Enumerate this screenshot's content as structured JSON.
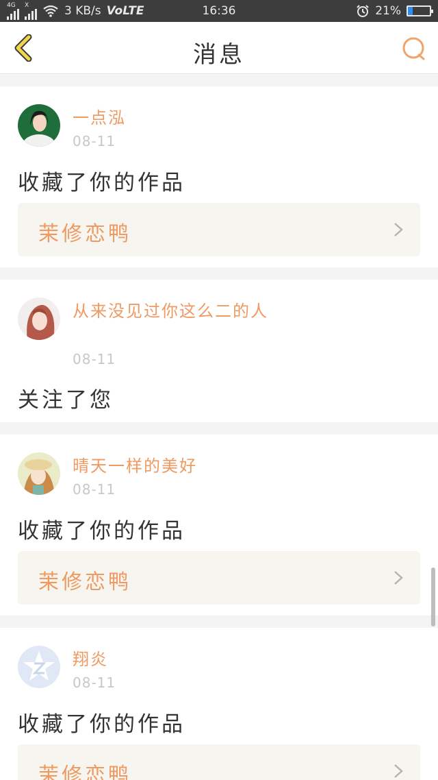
{
  "status_bar": {
    "network_top": "4G",
    "network_mark": "X",
    "speed": "3 KB/s",
    "volte": "VoLTE",
    "time": "16:36",
    "battery_text": "21%",
    "battery_level": 0.21,
    "battery_color": "#2e8fe6"
  },
  "header": {
    "title": "消息",
    "back_icon": "chevron-left-icon",
    "search_icon": "search-icon",
    "back_color": "#f2d64b",
    "search_color": "#f0a36a"
  },
  "colors": {
    "accent": "#ee9a62",
    "date": "#c8c8c8",
    "work_bg": "#f6f5ef"
  },
  "messages": [
    {
      "username": "一点泓",
      "date": "08-11",
      "action": "收藏了你的作品",
      "work_title": "茉修恋鸭"
    },
    {
      "username": "从来没见过你这么二的人",
      "date": "08-11",
      "action": "关注了您"
    },
    {
      "username": "晴天一样的美好",
      "date": "08-11",
      "action": "收藏了你的作品",
      "work_title": "茉修恋鸭"
    },
    {
      "username": "翔炎",
      "date": "08-11",
      "action": "收藏了你的作品",
      "work_title": "茉修恋鸭"
    }
  ]
}
